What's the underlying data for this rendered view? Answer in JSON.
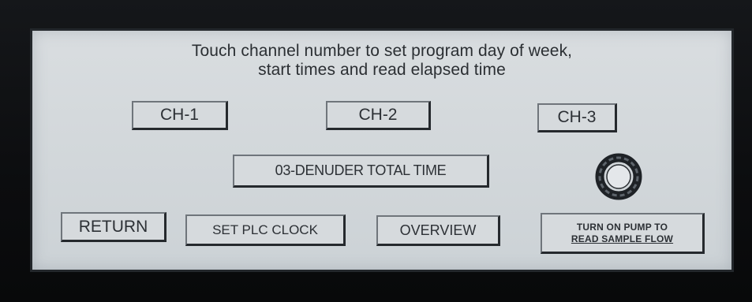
{
  "screen": {
    "instruction_line1": "Touch channel number to set program day of week,",
    "instruction_line2": "start times and read elapsed time"
  },
  "channels": [
    {
      "label": "CH-1"
    },
    {
      "label": "CH-2"
    },
    {
      "label": "CH-3"
    }
  ],
  "denuder_button": {
    "label": "03-DENUDER TOTAL TIME"
  },
  "status_icon": "ring-indicator-icon",
  "bottom_buttons": {
    "return_label": "RETURN",
    "set_clock_label": "SET PLC CLOCK",
    "overview_label": "OVERVIEW",
    "pump_line1": "TURN ON PUMP TO",
    "pump_line2": "READ SAMPLE FLOW"
  },
  "colors": {
    "screen_background": "#d6dadd",
    "text": "#2c3035",
    "bezel": "#0d0e10"
  }
}
